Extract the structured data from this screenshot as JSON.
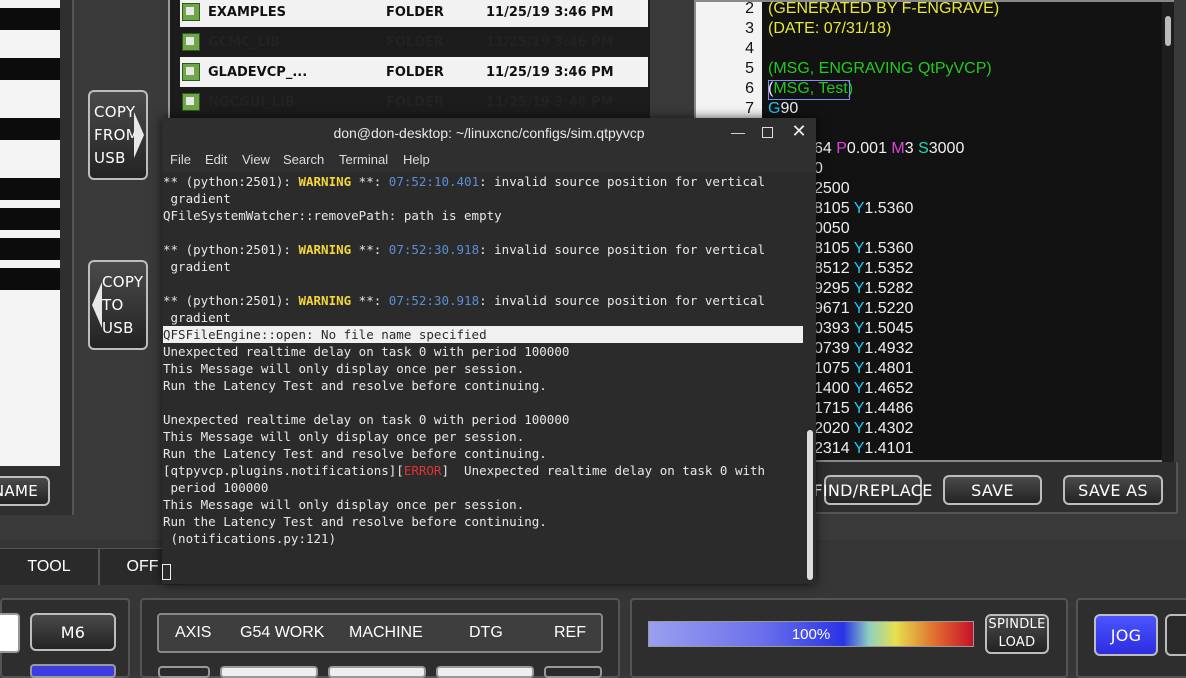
{
  "left_panel": {
    "name_button_label": "NAME"
  },
  "file_browser": {
    "rows": [
      {
        "name": "EXAMPLES",
        "type": "FOLDER",
        "date": "11/25/19 3:46 PM"
      },
      {
        "name": "GCMC_LIB",
        "type": "FOLDER",
        "date": "11/25/19 3:46 PM"
      },
      {
        "name": "GLADEVCP_...",
        "type": "FOLDER",
        "date": "11/25/19 3:46 PM"
      },
      {
        "name": "NGCGUI_LIB",
        "type": "FOLDER",
        "date": "11/25/19 3:46 PM"
      }
    ]
  },
  "usb": {
    "copy_from_lines": [
      "COPY",
      "FROM",
      "USB"
    ],
    "copy_to_lines": [
      "COPY",
      "TO",
      "USB"
    ]
  },
  "editor": {
    "line_numbers": [
      "2",
      "3",
      "4",
      "5",
      "6",
      "7"
    ],
    "lines": [
      [
        {
          "t": "(GENERATED BY F-ENGRAVE)",
          "c": "c-yel"
        }
      ],
      [
        {
          "t": "(DATE: 07/31/18)",
          "c": "c-yel"
        }
      ],
      [],
      [
        {
          "t": "(MSG, ENGRAVING QtPyVCP)",
          "c": "c-grn"
        }
      ],
      [
        {
          "t": "(",
          "c": "c-wht"
        },
        {
          "t": "MSG, Test)",
          "c": "c-grn"
        }
      ],
      [
        {
          "t": "G",
          "c": "c-cyan"
        },
        {
          "t": "90",
          "c": "c-wht"
        }
      ],
      [],
      [
        {
          "t": "64 ",
          "c": "c-wht"
        },
        {
          "t": "P",
          "c": "c-mag"
        },
        {
          "t": "0.001 ",
          "c": "c-wht"
        },
        {
          "t": "M",
          "c": "c-mag"
        },
        {
          "t": "3 ",
          "c": "c-wht"
        },
        {
          "t": "S",
          "c": "c-teal"
        },
        {
          "t": "3000",
          "c": "c-wht"
        }
      ],
      [
        {
          "t": "0",
          "c": "c-wht"
        }
      ],
      [
        {
          "t": "2500",
          "c": "c-wht"
        }
      ],
      [
        {
          "t": "8105 ",
          "c": "c-wht"
        },
        {
          "t": "Y",
          "c": "c-cyan"
        },
        {
          "t": "1.5360",
          "c": "c-wht"
        }
      ],
      [
        {
          "t": "0050",
          "c": "c-wht"
        }
      ],
      [
        {
          "t": "8105 ",
          "c": "c-wht"
        },
        {
          "t": "Y",
          "c": "c-cyan"
        },
        {
          "t": "1.5360",
          "c": "c-wht"
        }
      ],
      [
        {
          "t": "8512 ",
          "c": "c-wht"
        },
        {
          "t": "Y",
          "c": "c-cyan"
        },
        {
          "t": "1.5352",
          "c": "c-wht"
        }
      ],
      [
        {
          "t": "9295 ",
          "c": "c-wht"
        },
        {
          "t": "Y",
          "c": "c-cyan"
        },
        {
          "t": "1.5282",
          "c": "c-wht"
        }
      ],
      [
        {
          "t": "9671 ",
          "c": "c-wht"
        },
        {
          "t": "Y",
          "c": "c-cyan"
        },
        {
          "t": "1.5220",
          "c": "c-wht"
        }
      ],
      [
        {
          "t": "0393 ",
          "c": "c-wht"
        },
        {
          "t": "Y",
          "c": "c-cyan"
        },
        {
          "t": "1.5045",
          "c": "c-wht"
        }
      ],
      [
        {
          "t": "0739 ",
          "c": "c-wht"
        },
        {
          "t": "Y",
          "c": "c-cyan"
        },
        {
          "t": "1.4932",
          "c": "c-wht"
        }
      ],
      [
        {
          "t": "1075 ",
          "c": "c-wht"
        },
        {
          "t": "Y",
          "c": "c-cyan"
        },
        {
          "t": "1.4801",
          "c": "c-wht"
        }
      ],
      [
        {
          "t": "1400 ",
          "c": "c-wht"
        },
        {
          "t": "Y",
          "c": "c-cyan"
        },
        {
          "t": "1.4652",
          "c": "c-wht"
        }
      ],
      [
        {
          "t": "1715 ",
          "c": "c-wht"
        },
        {
          "t": "Y",
          "c": "c-cyan"
        },
        {
          "t": "1.4486",
          "c": "c-wht"
        }
      ],
      [
        {
          "t": "2020 ",
          "c": "c-wht"
        },
        {
          "t": "Y",
          "c": "c-cyan"
        },
        {
          "t": "1.4302",
          "c": "c-wht"
        }
      ],
      [
        {
          "t": "2314 ",
          "c": "c-wht"
        },
        {
          "t": "Y",
          "c": "c-cyan"
        },
        {
          "t": "1.4101",
          "c": "c-wht"
        }
      ]
    ],
    "buttons": {
      "find_replace": "FIND/REPLACE",
      "save": "SAVE",
      "save_as": "SAVE AS"
    }
  },
  "terminal": {
    "title": "don@don-desktop: ~/linuxcnc/configs/sim.qtpyvcp",
    "menu": [
      "File",
      "Edit",
      "View",
      "Search",
      "Terminal",
      "Help"
    ],
    "lines": [
      [
        {
          "t": "** (python:2501): "
        },
        {
          "t": "WARNING",
          "c": "t-warn"
        },
        {
          "t": " **: "
        },
        {
          "t": "07:52:10.401",
          "c": "t-time"
        },
        {
          "t": ": invalid source position for vertical"
        }
      ],
      [
        {
          "t": " gradient"
        }
      ],
      [
        {
          "t": "QFileSystemWatcher::removePath: path is empty"
        }
      ],
      [],
      [
        {
          "t": "** (python:2501): "
        },
        {
          "t": "WARNING",
          "c": "t-warn"
        },
        {
          "t": " **: "
        },
        {
          "t": "07:52:30.918",
          "c": "t-time"
        },
        {
          "t": ": invalid source position for vertical"
        }
      ],
      [
        {
          "t": " gradient"
        }
      ],
      [],
      [
        {
          "t": "** (python:2501): "
        },
        {
          "t": "WARNING",
          "c": "t-warn"
        },
        {
          "t": " **: "
        },
        {
          "t": "07:52:30.918",
          "c": "t-time"
        },
        {
          "t": ": invalid source position for vertical"
        }
      ],
      [
        {
          "t": " gradient"
        }
      ],
      [
        {
          "t": "QFSFileEngine::open: No file name specified",
          "hl": true
        }
      ],
      [
        {
          "t": "Unexpected realtime delay on task 0 with period 100000"
        }
      ],
      [
        {
          "t": "This Message will only display once per session."
        }
      ],
      [
        {
          "t": "Run the Latency Test and resolve before continuing."
        }
      ],
      [],
      [
        {
          "t": "Unexpected realtime delay on task 0 with period 100000"
        }
      ],
      [
        {
          "t": "This Message will only display once per session."
        }
      ],
      [
        {
          "t": "Run the Latency Test and resolve before continuing."
        }
      ],
      [
        {
          "t": "[qtpyvcp.plugins.notifications]["
        },
        {
          "t": "ERROR",
          "c": "t-err"
        },
        {
          "t": "]  Unexpected realtime delay on task 0 with"
        }
      ],
      [
        {
          "t": " period 100000"
        }
      ],
      [
        {
          "t": "This Message will only display once per session."
        }
      ],
      [
        {
          "t": "Run the Latency Test and resolve before continuing."
        }
      ],
      [
        {
          "t": " (notifications.py:121)"
        }
      ]
    ]
  },
  "tool_bar": {
    "tool_label": "TOOL",
    "offset_label": "OFF"
  },
  "m6_label": "M6",
  "dro_tabs": [
    "AXIS",
    "G54 WORK",
    "MACHINE",
    "DTG",
    "REF"
  ],
  "spindle": {
    "load_percent_text": "100%",
    "load_label_lines": [
      "SPINDLE",
      "LOAD"
    ]
  },
  "jog_label": "JOG"
}
